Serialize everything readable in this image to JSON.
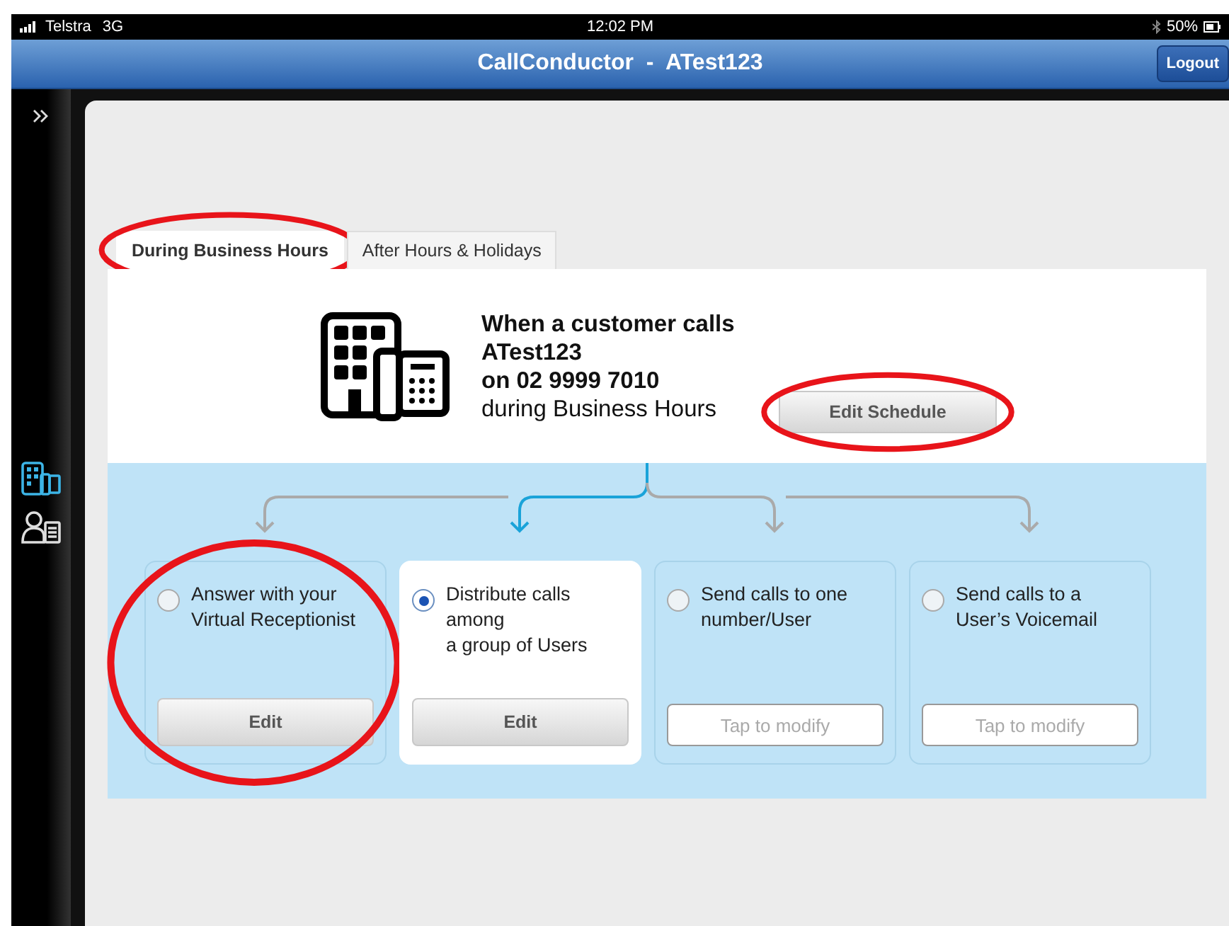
{
  "status_bar": {
    "carrier": "Telstra",
    "network": "3G",
    "time": "12:02 PM",
    "battery": "50%"
  },
  "nav_bar": {
    "title": "CallConductor  -  ATest123",
    "logout": "Logout"
  },
  "sidebar": {
    "items": [
      {
        "kind": "building",
        "selected": true
      },
      {
        "kind": "person",
        "selected": false
      }
    ]
  },
  "tabs": [
    {
      "label": "During Business Hours",
      "selected": true,
      "circled": true
    },
    {
      "label": "After Hours & Holidays",
      "selected": false,
      "circled": false
    }
  ],
  "header": {
    "lines": [
      "When a customer calls",
      "ATest123",
      "on 02 9999 7010"
    ],
    "subline": "during Business Hours",
    "edit_schedule": {
      "label": "Edit Schedule",
      "circled": true
    }
  },
  "options": [
    {
      "text": "Answer with your Virtual Receptionist",
      "selected": false,
      "circled": true,
      "action": {
        "kind": "button",
        "label": "Edit"
      }
    },
    {
      "text": "Distribute calls among\na group of Users",
      "selected": true,
      "circled": false,
      "action": {
        "kind": "button",
        "label": "Edit"
      }
    },
    {
      "text": "Send calls to one number/User",
      "selected": false,
      "circled": false,
      "action": {
        "kind": "field",
        "placeholder": "Tap to modify"
      }
    },
    {
      "text": "Send calls to a User’s Voicemail",
      "selected": false,
      "circled": false,
      "action": {
        "kind": "field",
        "placeholder": "Tap to modify"
      }
    }
  ]
}
